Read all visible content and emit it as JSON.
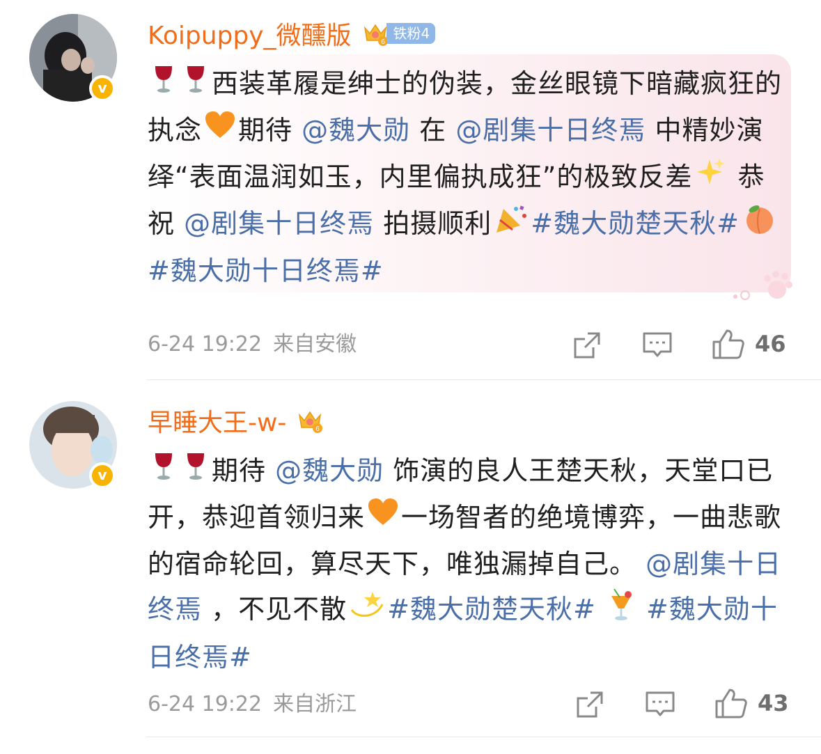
{
  "comments": [
    {
      "username": "Koipuppy_微醺版",
      "fan_badge": "铁粉4",
      "crown_level": "6",
      "verified_mark": "v",
      "text": {
        "p1": "西装革履是绅士的伪装，金丝眼镜下暗藏疯狂的执念",
        "p2": "期待",
        "m1": "@魏大勋",
        "p3": "在",
        "m2": "@剧集十日终焉",
        "p4": "中精妙演绎“表面温润如玉，内里偏执成狂”的极致反差",
        "p5": "恭祝",
        "m3": "@剧集十日终焉",
        "p6": "拍摄顺利",
        "h1": "#魏大勋楚天秋#",
        "h2": "#魏大勋十日终焉#"
      },
      "date": "6-24 19:22",
      "location": "来自安徽",
      "like_count": "46"
    },
    {
      "username": "早睡大王-w-",
      "crown_level": "6",
      "verified_mark": "v",
      "text": {
        "p1": "期待",
        "m1": "@魏大勋",
        "p2": "饰演的良人王楚天秋，天堂口已开，恭迎首领归来",
        "p3": "一场智者的绝境博弈，一曲悲歌的宿命轮回，算尽天下，唯独漏掉自己。",
        "m2": "@剧集十日终焉",
        "p4": "，不见不散",
        "h1": "#魏大勋楚天秋#",
        "h2": "#魏大勋十日终焉#"
      },
      "date": "6-24 19:22",
      "location": "来自浙江",
      "like_count": "43"
    }
  ],
  "icons": [
    "wine-glass-icon",
    "orange-heart-icon",
    "sparkles-icon",
    "party-popper-icon",
    "peach-icon",
    "dizzy-star-icon",
    "tropical-drink-icon",
    "crown-icon",
    "share-icon",
    "comment-icon",
    "like-icon",
    "paw-icon"
  ],
  "colors": {
    "username": "#f26d1a",
    "link": "#4a6ea8",
    "meta": "#9a9a9a",
    "verified": "#f8b400",
    "fan_badge": "#8fb8e8",
    "bubble": "#f9e4ea"
  }
}
